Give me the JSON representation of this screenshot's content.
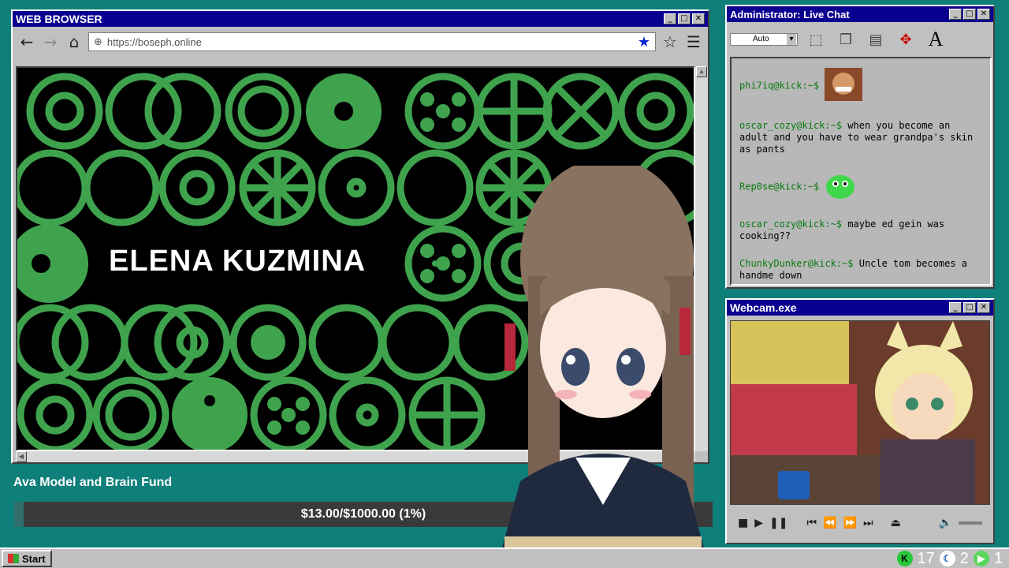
{
  "browser": {
    "title": "WEB BROWSER",
    "url": "https://boseph.online",
    "slide_title": "ELENA KUZMINA"
  },
  "chat": {
    "title": "Administrator: Live Chat",
    "font_select": "Auto",
    "messages": [
      {
        "user": "phi7iq@kick:~$",
        "text": "",
        "emote": "laughing-man-emote"
      },
      {
        "user": "oscar_cozy@kick:~$",
        "text": "when you become an adult and you have to wear grandpa's skin as pants"
      },
      {
        "user": "Rep0se@kick:~$",
        "text": "",
        "emote": "green-blob-emote"
      },
      {
        "user": "oscar_cozy@kick:~$",
        "text": "maybe ed gein was cooking??"
      },
      {
        "user": "ChunkyDunker@kick:~$",
        "text": "Uncle tom becomes a handme down"
      }
    ]
  },
  "webcam": {
    "title": "Webcam.exe"
  },
  "fund": {
    "title": "Ava Model and Brain Fund",
    "progress_text": "$13.00/$1000.00 (1%)",
    "progress_fraction": 0.013
  },
  "taskbar": {
    "start_label": "Start",
    "tray_kick_count": "17",
    "tray_moon_count": "2",
    "tray_play_count": "1"
  },
  "colors": {
    "title_bar": "#0a0090",
    "desktop": "#0f7f7a",
    "chat_user": "#0a7a12",
    "slide_green": "#3fa34d"
  }
}
